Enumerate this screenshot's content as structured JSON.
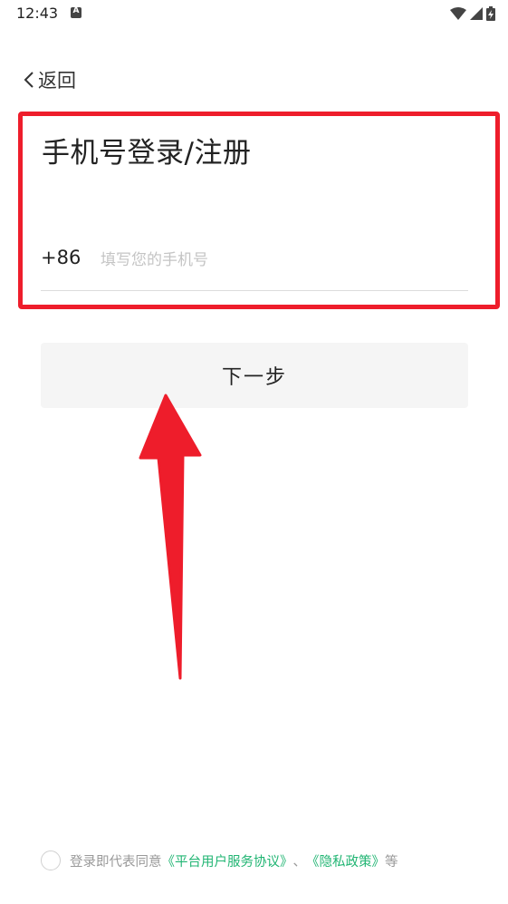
{
  "status_bar": {
    "time": "12:43",
    "notification_icon": "a-badge-icon",
    "wifi_icon": "wifi-icon",
    "signal_icon": "signal-icon",
    "battery_icon": "battery-charging-icon"
  },
  "header": {
    "back_label": "返回"
  },
  "login": {
    "title": "手机号登录/注册",
    "country_code": "+86",
    "phone_placeholder": "填写您的手机号",
    "phone_value": ""
  },
  "actions": {
    "next_label": "下一步"
  },
  "agreement": {
    "prefix": "登录即代表同意",
    "link_terms": "《平台用户服务协议》",
    "separator": "、",
    "link_privacy": "《隐私政策》",
    "suffix": "等"
  },
  "colors": {
    "annotation_red": "#ee1d2b",
    "link_green": "#21b573",
    "button_bg": "#f5f5f5"
  }
}
